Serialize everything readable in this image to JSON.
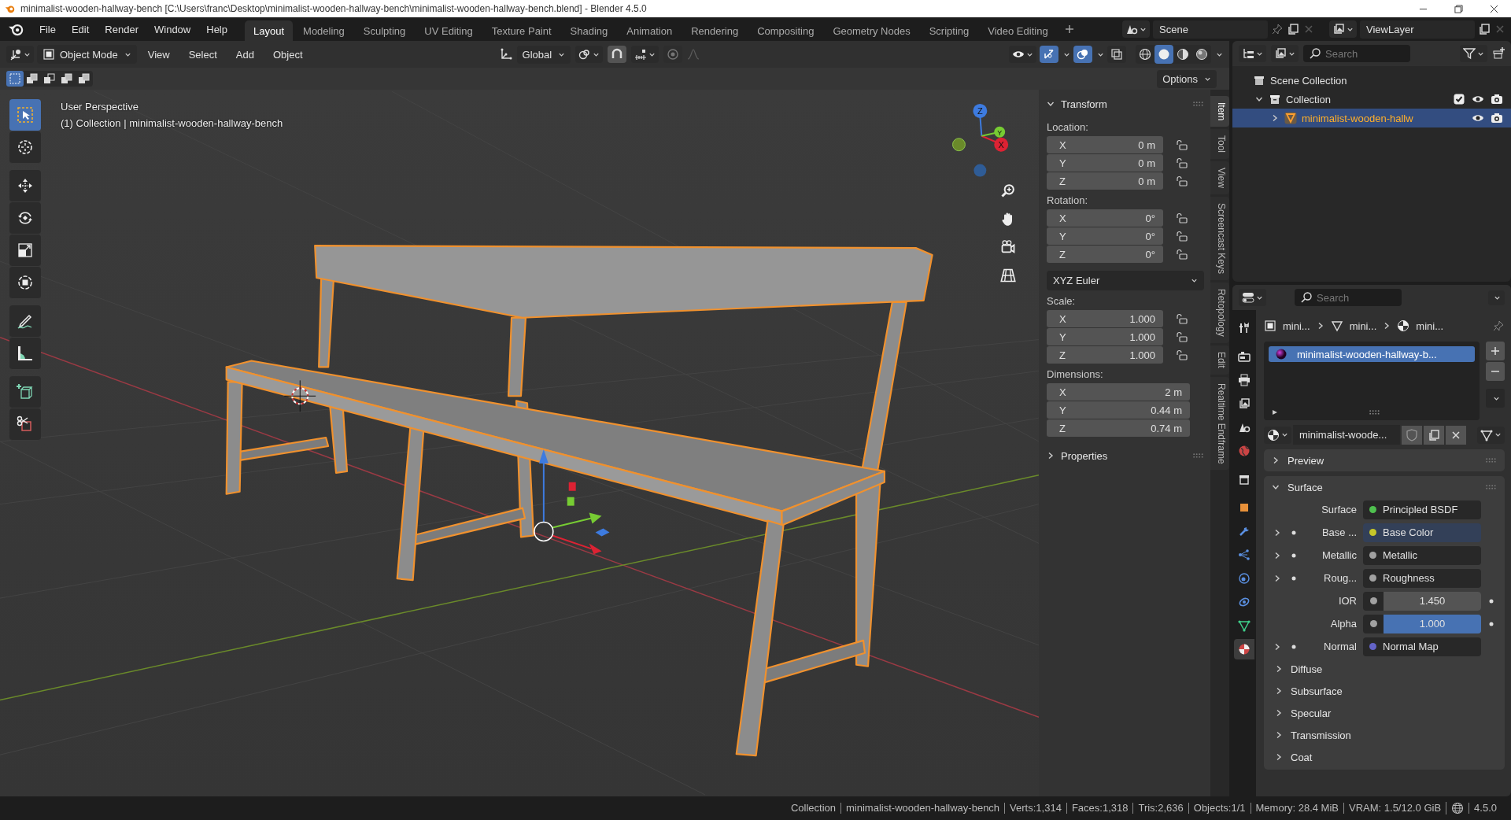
{
  "window": {
    "title": "minimalist-wooden-hallway-bench [C:\\Users\\franc\\Desktop\\minimalist-wooden-hallway-bench\\minimalist-wooden-hallway-bench.blend] - Blender 4.5.0"
  },
  "menu": [
    "File",
    "Edit",
    "Render",
    "Window",
    "Help"
  ],
  "workspaces": [
    {
      "label": "Layout",
      "selected": true
    },
    {
      "label": "Modeling",
      "selected": false
    },
    {
      "label": "Sculpting",
      "selected": false
    },
    {
      "label": "UV Editing",
      "selected": false
    },
    {
      "label": "Texture Paint",
      "selected": false
    },
    {
      "label": "Shading",
      "selected": false
    },
    {
      "label": "Animation",
      "selected": false
    },
    {
      "label": "Rendering",
      "selected": false
    },
    {
      "label": "Compositing",
      "selected": false
    },
    {
      "label": "Geometry Nodes",
      "selected": false
    },
    {
      "label": "Scripting",
      "selected": false
    },
    {
      "label": "Video Editing",
      "selected": false
    }
  ],
  "scene": "Scene",
  "view_layer": "ViewLayer",
  "viewport": {
    "mode": "Object Mode",
    "menus": [
      "View",
      "Select",
      "Add",
      "Object"
    ],
    "orientation": "Global",
    "snap": true,
    "proportional": false,
    "gizmos": true,
    "overlays": true,
    "xray": false,
    "shading": [
      {
        "selected": false
      },
      {
        "selected": true
      },
      {
        "selected": false
      },
      {
        "selected": false
      }
    ],
    "select_modes": [
      {
        "selected": true
      },
      {
        "selected": false
      },
      {
        "selected": false
      },
      {
        "selected": false
      },
      {
        "selected": false
      }
    ],
    "options": "Options",
    "view_name": "User Perspective",
    "object_info": "(1) Collection | minimalist-wooden-hallway-bench",
    "axes": [
      "Z",
      "Y",
      "X"
    ],
    "tools": [
      {
        "selected": true
      },
      {
        "selected": false
      },
      {
        "selected": false
      },
      {
        "selected": false
      },
      {
        "selected": false
      },
      {
        "selected": false
      },
      {
        "selected": false
      },
      {
        "selected": false
      },
      {
        "selected": false
      },
      {
        "selected": false
      }
    ]
  },
  "sidebar": {
    "tabs": [
      {
        "label": "Item",
        "selected": true
      },
      {
        "label": "Tool",
        "selected": false
      },
      {
        "label": "View",
        "selected": false
      },
      {
        "label": "Screencast Keys",
        "selected": false
      },
      {
        "label": "Retopology",
        "selected": false
      },
      {
        "label": "Edit",
        "selected": false
      },
      {
        "label": "Realtime Endframe",
        "selected": false
      }
    ],
    "transform": {
      "title": "Transform",
      "expanded": true,
      "groups": [
        {
          "label": "Location:",
          "fields": [
            {
              "axis": "X",
              "value": "0 m",
              "locked": false
            },
            {
              "axis": "Y",
              "value": "0 m",
              "locked": false
            },
            {
              "axis": "Z",
              "value": "0 m",
              "locked": false
            }
          ]
        },
        {
          "label": "Rotation:",
          "fields": [
            {
              "axis": "X",
              "value": "0°",
              "locked": false
            },
            {
              "axis": "Y",
              "value": "0°",
              "locked": false
            },
            {
              "axis": "Z",
              "value": "0°",
              "locked": false
            }
          ],
          "mode": "XYZ Euler"
        },
        {
          "label": "Scale:",
          "fields": [
            {
              "axis": "X",
              "value": "1.000",
              "locked": false
            },
            {
              "axis": "Y",
              "value": "1.000",
              "locked": false
            },
            {
              "axis": "Z",
              "value": "1.000",
              "locked": false
            }
          ]
        },
        {
          "label": "Dimensions:",
          "fields": [
            {
              "axis": "X",
              "value": "2 m"
            },
            {
              "axis": "Y",
              "value": "0.44 m"
            },
            {
              "axis": "Z",
              "value": "0.74 m"
            }
          ]
        }
      ]
    },
    "properties": {
      "title": "Properties",
      "expanded": false
    }
  },
  "outliner": {
    "search_placeholder": "Search",
    "tree": [
      {
        "label": "Scene Collection",
        "kind": "scene",
        "selected": false,
        "children": [
          {
            "label": "Collection",
            "kind": "collection",
            "expanded": true,
            "checked": true,
            "selected": false,
            "children": [
              {
                "label": "minimalist-wooden-hallw",
                "kind": "object",
                "expanded": false,
                "selected": true
              }
            ]
          }
        ]
      }
    ]
  },
  "properties_editor": {
    "search_placeholder": "Search",
    "tabs": [
      {
        "selected": false
      },
      {
        "selected": false
      },
      {
        "selected": false
      },
      {
        "selected": false
      },
      {
        "selected": false
      },
      {
        "selected": false
      },
      {
        "selected": false
      },
      {
        "selected": false
      },
      {
        "selected": false
      },
      {
        "selected": false
      },
      {
        "selected": false
      },
      {
        "selected": false
      },
      {
        "selected": false
      },
      {
        "selected": true
      }
    ],
    "breadcrumb": [
      "mini...",
      "mini...",
      "mini..."
    ],
    "material_slots": [
      {
        "name": "minimalist-wooden-hallway-b...",
        "selected": true
      }
    ],
    "material": "minimalist-woode...",
    "panels": [
      {
        "title": "Preview",
        "expanded": false
      },
      {
        "title": "Surface",
        "expanded": true,
        "rows": [
          {
            "kind": "shader",
            "label": "Surface",
            "value": "Principled BSDF",
            "color": "#4fc04f"
          },
          {
            "kind": "link",
            "label": "Base ...",
            "value": "Base Color",
            "color": "#c7c729"
          },
          {
            "kind": "link",
            "label": "Metallic",
            "value": "Metallic",
            "color": "#a1a1a1"
          },
          {
            "kind": "link",
            "label": "Roug...",
            "value": "Roughness",
            "color": "#a1a1a1"
          },
          {
            "kind": "number",
            "label": "IOR",
            "value": "1.450",
            "color": "#a1a1a1"
          },
          {
            "kind": "slider",
            "label": "Alpha",
            "value": "1.000",
            "color": "#a1a1a1",
            "level": 1
          },
          {
            "kind": "link",
            "label": "Normal",
            "value": "Normal Map",
            "color": "#6363c7"
          }
        ],
        "subpanels": [
          {
            "title": "Diffuse",
            "expanded": false
          },
          {
            "title": "Subsurface",
            "expanded": false
          },
          {
            "title": "Specular",
            "expanded": false
          },
          {
            "title": "Transmission",
            "expanded": false
          },
          {
            "title": "Coat",
            "expanded": false
          }
        ]
      }
    ]
  },
  "status": {
    "items": [
      "Collection",
      "minimalist-wooden-hallway-bench",
      "Verts:1,314",
      "Faces:1,318",
      "Tris:2,636",
      "Objects:1/1",
      "Memory: 28.4 MiB",
      "VRAM: 1.5/12.0 GiB"
    ],
    "version": "4.5.0"
  }
}
